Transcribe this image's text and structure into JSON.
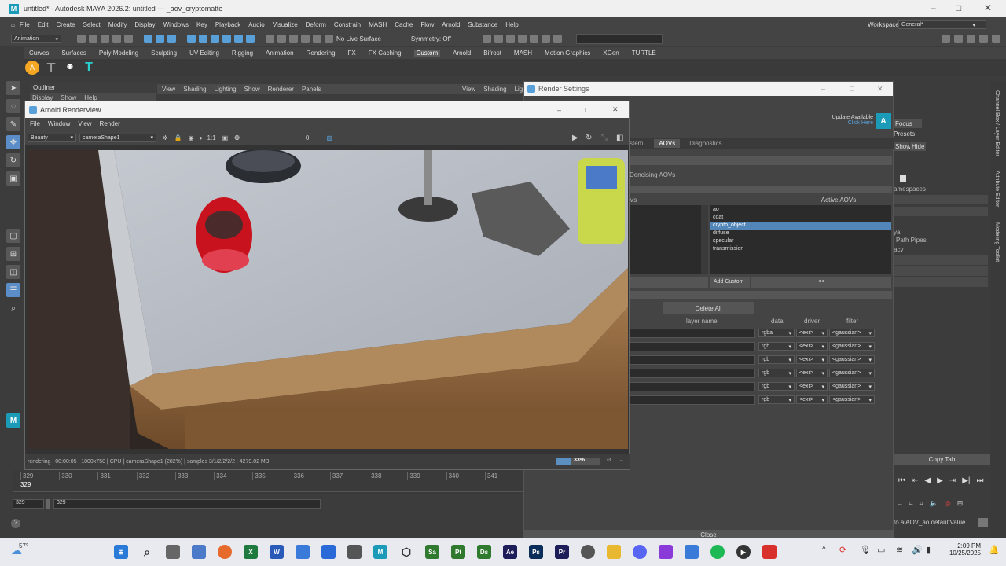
{
  "window": {
    "title": "untitled* - Autodesk MAYA 2026.2: untitled   ---   _aov_cryptomatte"
  },
  "menubar": [
    "File",
    "Edit",
    "Create",
    "Select",
    "Modify",
    "Display",
    "Windows",
    "Key",
    "Playback",
    "Audio",
    "Visualize",
    "Deform",
    "Constrain",
    "MASH",
    "Cache",
    "Flow",
    "Arnold",
    "Substance",
    "Help"
  ],
  "workspace": {
    "label": "Workspace:",
    "value": "General*"
  },
  "statusline": {
    "mode": "Animation",
    "live_surface": "No Live Surface",
    "symmetry": "Symmetry: Off"
  },
  "shelf_tabs": [
    "Curves",
    "Surfaces",
    "Poly Modeling",
    "Sculpting",
    "UV Editing",
    "Rigging",
    "Animation",
    "Rendering",
    "FX",
    "FX Caching",
    "Custom",
    "Arnold",
    "Bifrost",
    "MASH",
    "Motion Graphics",
    "XGen",
    "TURTLE"
  ],
  "shelf_active": "Custom",
  "outliner": {
    "title": "Outliner",
    "menu": [
      "Display",
      "Show",
      "Help"
    ]
  },
  "panel_menu": [
    "View",
    "Shading",
    "Lighting",
    "Show",
    "Renderer",
    "Panels"
  ],
  "panel2_menu": [
    "View",
    "Shading",
    "Lighti"
  ],
  "render_settings": {
    "title": "Render Settings",
    "update": "Update Available",
    "click_here": "Click Here",
    "tabs": [
      "stem",
      "AOVs",
      "Diagnostics"
    ],
    "denoising": "Denoising AOVs",
    "left_col": "Vs",
    "active_header": "Active AOVs",
    "active_aovs": [
      "ao",
      "coat",
      "crypto_object",
      "diffuse",
      "specular",
      "transmission"
    ],
    "selected_aov": "crypto_object",
    "add_custom": "Add Custom",
    "move_left": "<<",
    "delete_all": "Delete All",
    "col_headers": [
      "layer name",
      "data",
      "driver",
      "filter"
    ],
    "rows": [
      {
        "data": "rgba",
        "driver": "<exr>",
        "filter": "<gaussian>"
      },
      {
        "data": "rgb",
        "driver": "<exr>",
        "filter": "<gaussian>"
      },
      {
        "data": "rgb",
        "driver": "<exr>",
        "filter": "<gaussian>"
      },
      {
        "data": "rgb",
        "driver": "<exr>",
        "filter": "<gaussian>"
      },
      {
        "data": "rgb",
        "driver": "<exr>",
        "filter": "<gaussian>"
      },
      {
        "data": "rgb",
        "driver": "<exr>",
        "filter": "<gaussian>"
      }
    ],
    "close": "Close"
  },
  "channel_box": {
    "focus": "Focus",
    "presets": "Presets",
    "show": "Show",
    "hide": "Hide",
    "namespaces": "amespaces",
    "path_pipes": "Path Pipes",
    "ya": "ya",
    "acy": "acy",
    "copy_tab": "Copy Tab",
    "cmd": "to aiAOV_ao.defaultValue"
  },
  "side_tabs": [
    "Channel Box / Layer Editor",
    "Attribute Editor",
    "Modeling Toolkit"
  ],
  "render_view": {
    "title": "Arnold RenderView",
    "menu": [
      "File",
      "Window",
      "View",
      "Render"
    ],
    "aov": "Beauty",
    "camera": "cameraShape1",
    "ratio": "1:1",
    "exposure": "0",
    "status": "rendering | 00:00:05 | 1000x750 | CPU | cameraShape1 (282%) | samples 3/1/2/2/2/2 | 4279.02 MB",
    "progress": "33%",
    "progress_value": 0.33
  },
  "timeline": {
    "current": "329",
    "ticks": [
      "329",
      "330",
      "331",
      "332",
      "333",
      "334",
      "335",
      "336",
      "337",
      "338",
      "339",
      "340",
      "341"
    ],
    "start": "329",
    "range_start": "329"
  },
  "taskbar": {
    "weather": "57°",
    "time": "2:09 PM",
    "date": "10/25/2025",
    "apps": [
      {
        "t": "Sa",
        "c": "#2f7a2f"
      },
      {
        "t": "Pt",
        "c": "#2f7a2f"
      },
      {
        "t": "Ds",
        "c": "#2f7a2f"
      },
      {
        "t": "Ae",
        "c": "#1d1d5a"
      },
      {
        "t": "Ps",
        "c": "#0b2d5a"
      },
      {
        "t": "Pr",
        "c": "#1d1d5a"
      }
    ]
  }
}
